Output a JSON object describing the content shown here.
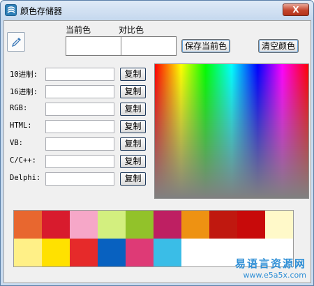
{
  "window": {
    "title": "颜色存储器",
    "close_label": "X"
  },
  "header": {
    "current_color_label": "当前色",
    "compare_color_label": "对比色",
    "save_button": "保存当前色",
    "clear_button": "清空颜色"
  },
  "rows": [
    {
      "label": "10进制:",
      "value": "",
      "copy": "复制"
    },
    {
      "label": "16进制:",
      "value": "",
      "copy": "复制"
    },
    {
      "label": "RGB:",
      "value": "",
      "copy": "复制"
    },
    {
      "label": "HTML:",
      "value": "",
      "copy": "复制"
    },
    {
      "label": "VB:",
      "value": "",
      "copy": "复制"
    },
    {
      "label": "C/C++:",
      "value": "",
      "copy": "复制"
    },
    {
      "label": "Delphi:",
      "value": "",
      "copy": "复制"
    }
  ],
  "palette": {
    "row1": [
      "#e8672f",
      "#d81b2d",
      "#f6a7c8",
      "#d3ef7f",
      "#92c22a",
      "#be1f62",
      "#ee9212",
      "#c0180f",
      "#c80a0a",
      "#fff9c9"
    ],
    "row2": [
      "#fff087",
      "#ffe100",
      "#e62a2a",
      "#0861c0",
      "#de3a76",
      "#3abde7"
    ]
  },
  "watermark": {
    "text": "易语言资源网",
    "url": "www.e5a5x.com"
  }
}
